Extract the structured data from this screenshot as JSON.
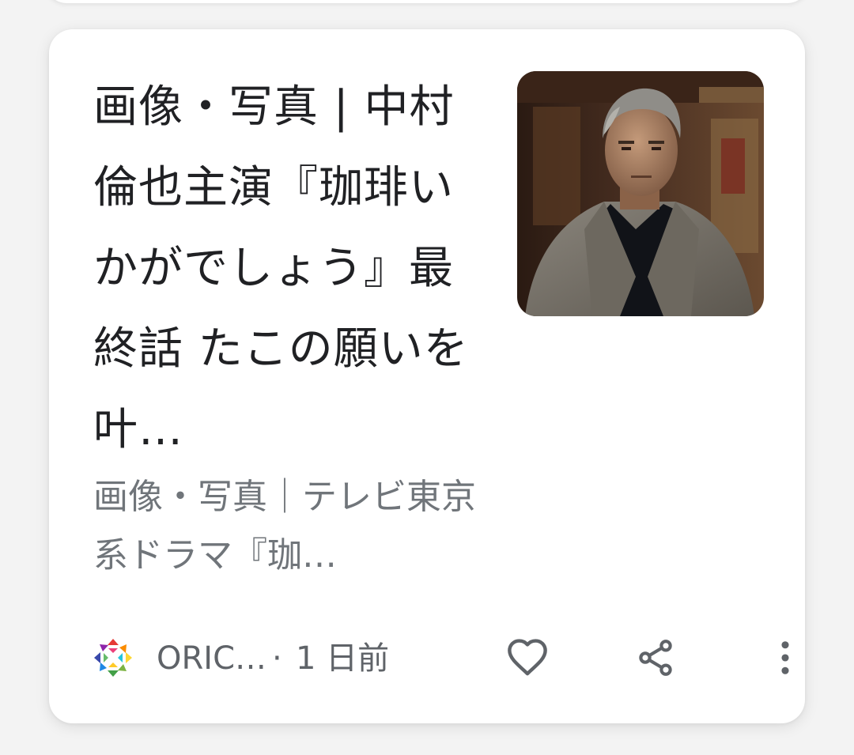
{
  "article": {
    "title": "画像・写真 | 中村倫也主演『珈琲いかがでしょう』最終話 たこの願いを叶…",
    "snippet": "画像・写真｜テレビ東京系ドラマ『珈…",
    "thumbnail_icon": "article-thumbnail-image"
  },
  "footer": {
    "source_name": "ORIC…",
    "separator": "·",
    "time": "1 日前",
    "icons": {
      "like": "heart-outline-icon",
      "share": "share-icon",
      "more": "more-vertical-icon"
    }
  },
  "colors": {
    "card_background": "#ffffff",
    "page_background": "#f3f3f3",
    "title_text": "#202124",
    "secondary_text": "#70757a",
    "icon": "#5f6368"
  }
}
